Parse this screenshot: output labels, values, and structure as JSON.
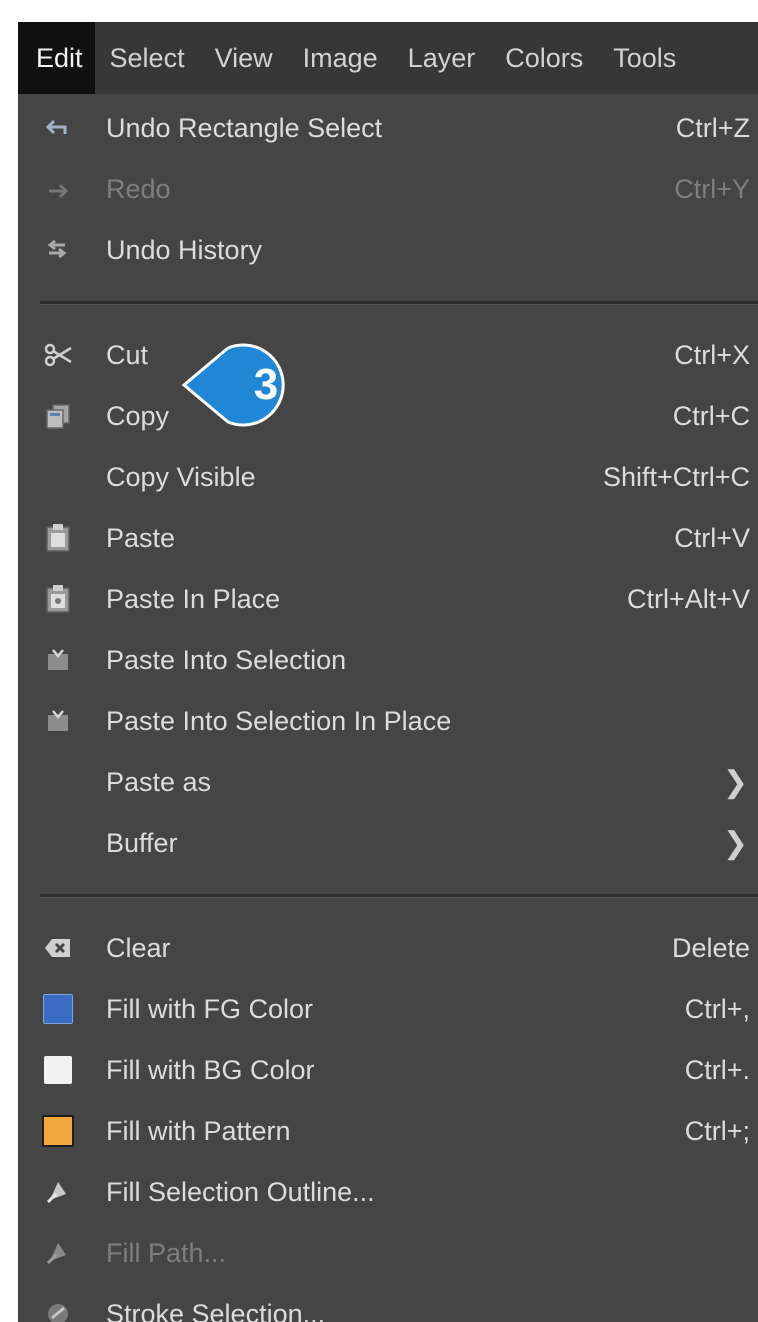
{
  "menubar": {
    "items": [
      "Edit",
      "Select",
      "View",
      "Image",
      "Layer",
      "Colors",
      "Tools"
    ]
  },
  "edit_menu": {
    "group1": [
      {
        "label": "Undo Rectangle Select",
        "accel": "Ctrl+Z",
        "icon": "undo-icon",
        "disabled": false
      },
      {
        "label": "Redo",
        "accel": "Ctrl+Y",
        "icon": "redo-icon",
        "disabled": true
      },
      {
        "label": "Undo History",
        "accel": "",
        "icon": "undo-history-icon",
        "disabled": false
      }
    ],
    "group2": [
      {
        "label": "Cut",
        "accel": "Ctrl+X",
        "icon": "scissors-icon"
      },
      {
        "label": "Copy",
        "accel": "Ctrl+C",
        "icon": "copy-icon"
      },
      {
        "label": "Copy Visible",
        "accel": "Shift+Ctrl+C",
        "icon": ""
      },
      {
        "label": "Paste",
        "accel": "Ctrl+V",
        "icon": "paste-icon"
      },
      {
        "label": "Paste In Place",
        "accel": "Ctrl+Alt+V",
        "icon": "paste-in-place-icon"
      },
      {
        "label": "Paste Into Selection",
        "accel": "",
        "icon": "paste-into-selection-icon"
      },
      {
        "label": "Paste Into Selection In Place",
        "accel": "",
        "icon": "paste-into-selection-in-place-icon"
      },
      {
        "label": "Paste as",
        "accel": "",
        "icon": "",
        "submenu": true
      },
      {
        "label": "Buffer",
        "accel": "",
        "icon": "",
        "submenu": true
      }
    ],
    "group3": [
      {
        "label": "Clear",
        "accel": "Delete",
        "icon": "clear-icon",
        "disabled": false
      },
      {
        "label": "Fill with FG Color",
        "accel": "Ctrl+,",
        "icon": "fg-color-swatch",
        "disabled": false
      },
      {
        "label": "Fill with BG Color",
        "accel": "Ctrl+.",
        "icon": "bg-color-swatch",
        "disabled": false
      },
      {
        "label": "Fill with Pattern",
        "accel": "Ctrl+;",
        "icon": "pattern-swatch",
        "disabled": false
      },
      {
        "label": "Fill Selection Outline...",
        "accel": "",
        "icon": "fill-selection-outline-icon",
        "disabled": false
      },
      {
        "label": "Fill Path...",
        "accel": "",
        "icon": "fill-path-icon",
        "disabled": true
      },
      {
        "label": "Stroke Selection...",
        "accel": "",
        "icon": "stroke-selection-icon",
        "disabled": false
      }
    ]
  },
  "callout": {
    "number": "3"
  },
  "colors": {
    "fg": "#3a6cc4",
    "bg": "#f2f2f2",
    "pattern": "#f2a73a",
    "callout": "#1f87d6"
  }
}
